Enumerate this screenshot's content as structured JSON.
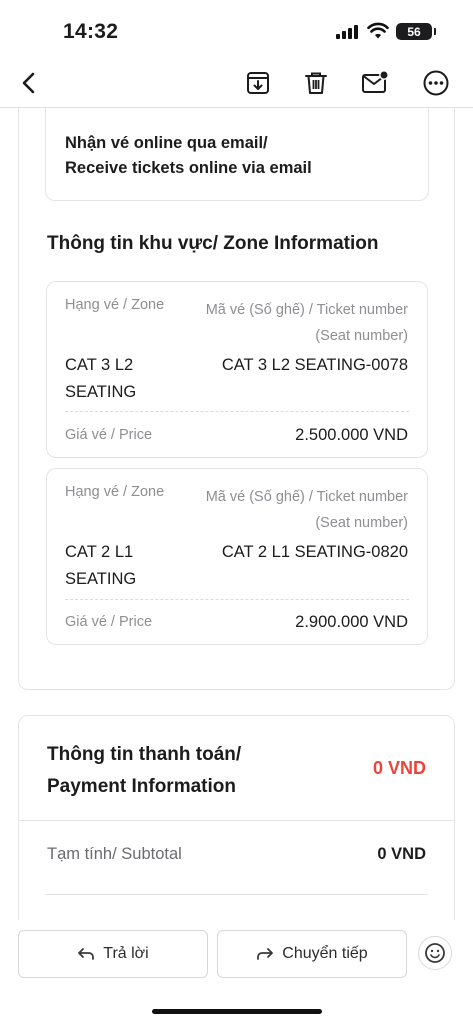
{
  "status_bar": {
    "time": "14:32",
    "battery": "56"
  },
  "toolbar": {
    "back_icon": "chevron-left-icon",
    "icons": [
      "archive-icon",
      "trash-icon",
      "mail-unread-icon",
      "more-icon"
    ]
  },
  "email": {
    "delivery_note_line1": "Nhận vé online qua email/",
    "delivery_note_line2": "Receive tickets online via email",
    "zone_title": "Thông tin khu vực/ Zone Information",
    "tickets": [
      {
        "zone_label": "Hạng vé / Zone",
        "ticket_label_line1": "Mã vé (Số ghế) / Ticket number",
        "ticket_label_line2": "(Seat number)",
        "zone_line1": "CAT 3 L2",
        "zone_line2": "SEATING",
        "ticket_number": "CAT 3 L2 SEATING-0078",
        "price_label": "Giá vé / Price",
        "price": "2.500.000 VND"
      },
      {
        "zone_label": "Hạng vé / Zone",
        "ticket_label_line1": "Mã vé (Số ghế) / Ticket number",
        "ticket_label_line2": "(Seat number)",
        "zone_line1": "CAT 2 L1",
        "zone_line2": "SEATING",
        "ticket_number": "CAT 2 L1 SEATING-0820",
        "price_label": "Giá vé / Price",
        "price": "2.900.000 VND"
      }
    ],
    "payment": {
      "title_line1": "Thông tin thanh toán/",
      "title_line2": "Payment Information",
      "total": "0 VND",
      "total_color": "#e8453c",
      "subtotal_label": "Tạm tính/ Subtotal",
      "subtotal": "0 VND"
    }
  },
  "actions": {
    "reply": "Trả lời",
    "forward": "Chuyển tiếp",
    "emoji_icon": "smiley-icon"
  }
}
